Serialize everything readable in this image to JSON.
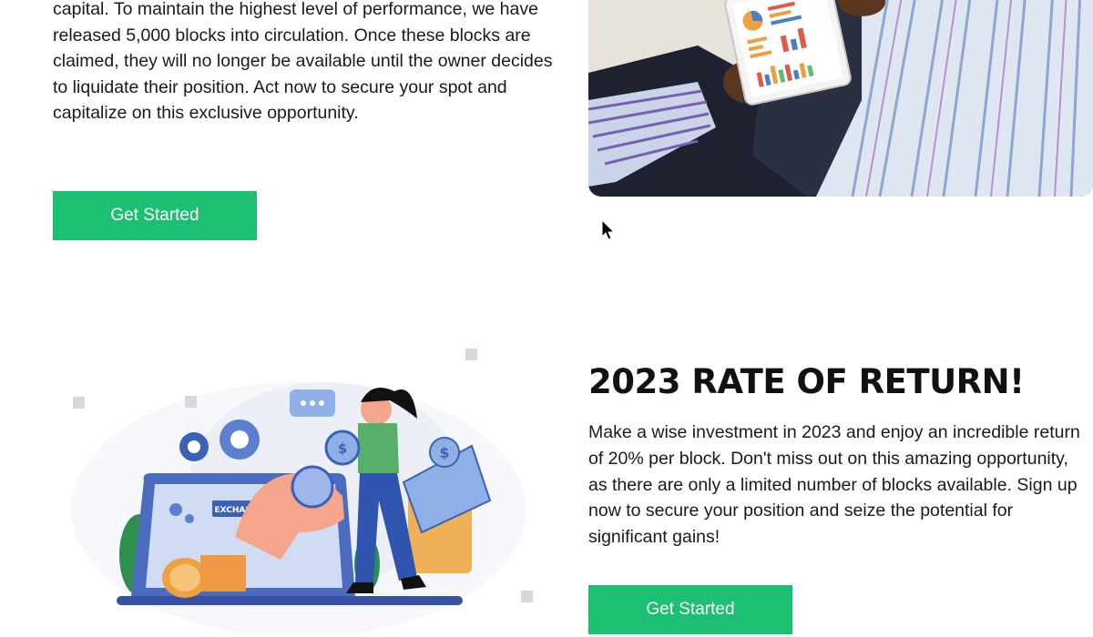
{
  "section_one": {
    "paragraph": "capital. To maintain the highest level of performance, we have released 5,000 blocks into circulation. Once these blocks are claimed, they will no longer be available until the owner decides to liquidate their position. Act now to secure your spot and capitalize on this exclusive opportunity.",
    "button_label": "Get Started"
  },
  "section_two": {
    "heading": "2023 RATE OF RETURN!",
    "paragraph": "Make a wise investment in 2023 and enjoy an incredible return of 20% per block. Don't miss out on this amazing opportunity, as there are only a limited number of blocks available. Sign up now to secure your position and seize the potential for significant gains!",
    "button_label": "Get Started",
    "illustration_label": "EXCHANGE"
  },
  "colors": {
    "accent": "#1dbf73",
    "text": "#1a1a1a"
  }
}
